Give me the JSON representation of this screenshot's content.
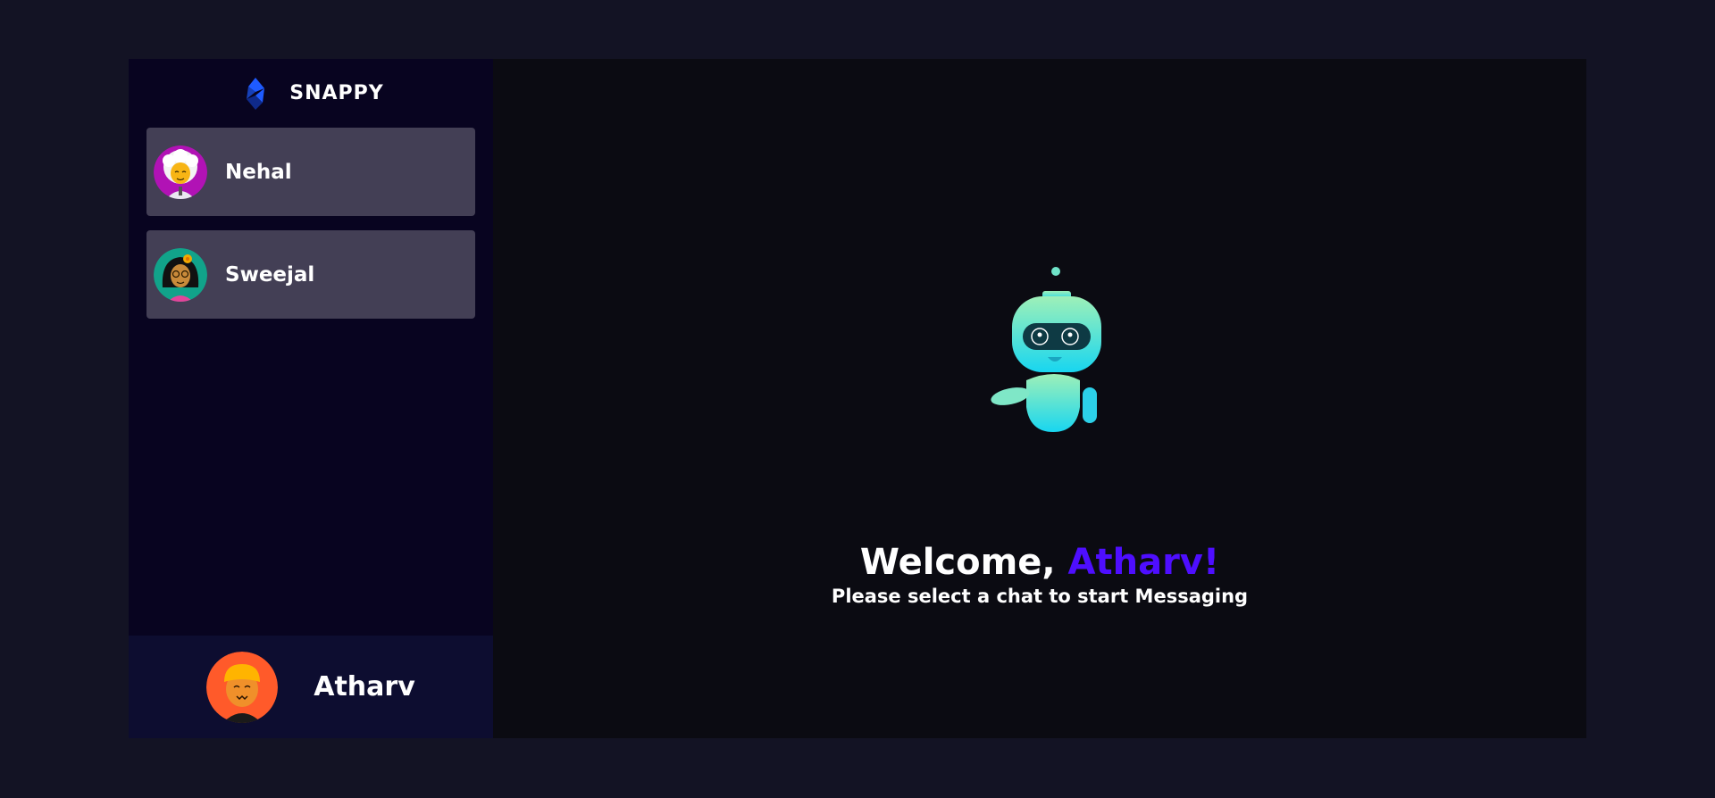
{
  "brand": {
    "name": "SNAPPY"
  },
  "contacts": [
    {
      "name": "Nehal",
      "avatar_icon": "woman-white-hair-avatar-icon"
    },
    {
      "name": "Sweejal",
      "avatar_icon": "woman-glasses-flower-avatar-icon"
    }
  ],
  "current_user": {
    "name": "Atharv",
    "avatar_icon": "boy-orange-hair-avatar-icon"
  },
  "welcome": {
    "greeting": "Welcome, ",
    "username": "Atharv!",
    "subtitle": "Please select a chat to start Messaging"
  },
  "colors": {
    "page_bg": "#131324",
    "sidebar_bg": "#080420",
    "contact_bg": "#433f55",
    "current_user_bg": "#0d0d30",
    "accent": "#4e0eff"
  }
}
